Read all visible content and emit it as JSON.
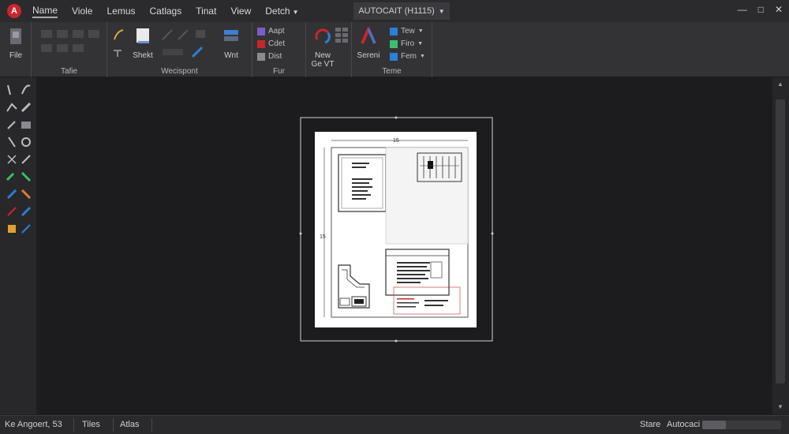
{
  "menu": {
    "items": [
      "Name",
      "Viole",
      "Lemus",
      "Catlags",
      "Tinat",
      "View",
      "Detch"
    ],
    "active_index": 0,
    "document_tab": "AUTOCAIT (H1115)"
  },
  "window": {
    "minimize": "—",
    "restore": "□",
    "close": "✕"
  },
  "ribbon": {
    "file_label": "File",
    "sheet_label": "Shekt",
    "wnt_label": "Wnt",
    "group_table": "Tafie",
    "group_workspace": "Wecispont",
    "group_fur": "Fur",
    "group_teme": "Teme",
    "fur_rows": [
      "Aapt",
      "Cdet",
      "Dist"
    ],
    "new_label": "New",
    "new_sub": "Ge VT",
    "sereni_label": "Sereni",
    "teme_rows": [
      "Tew",
      "Firo",
      "Fem"
    ]
  },
  "canvas": {
    "dim_top": "15",
    "dim_side": "15"
  },
  "status": {
    "coords": "Ke Angoert, 53",
    "tiles": "Tiles",
    "atlas": "Atlas",
    "state": "Stare",
    "app": "Autocaci",
    "progress": 0.3
  },
  "colors": {
    "accent_red": "#c8262d",
    "accent_blue": "#2b7fd6",
    "accent_green": "#3bbf6a",
    "paper": "#ffffff"
  }
}
